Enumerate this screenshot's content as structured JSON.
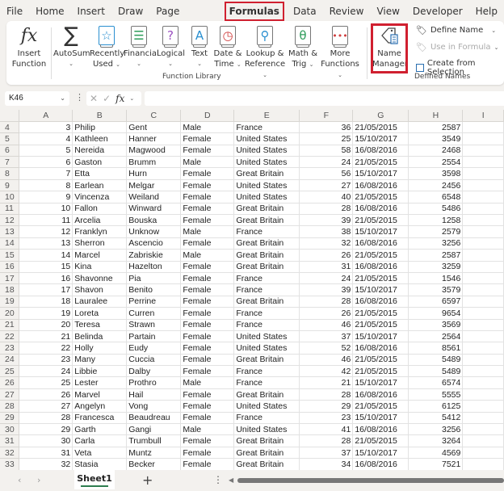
{
  "menu": {
    "tabs": [
      "File",
      "Home",
      "Insert",
      "Draw",
      "Page Layout",
      "Formulas",
      "Data",
      "Review",
      "View",
      "Developer",
      "Help"
    ],
    "active": "Formulas"
  },
  "ribbon": {
    "insert_function": [
      "Insert",
      "Function"
    ],
    "autosum": "AutoSum",
    "recently_used": [
      "Recently",
      "Used"
    ],
    "financial": "Financial",
    "logical": "Logical",
    "text": "Text",
    "date_time": [
      "Date &",
      "Time"
    ],
    "lookup_reference": [
      "Lookup &",
      "Reference"
    ],
    "math_trig": [
      "Math &",
      "Trig"
    ],
    "more_functions": [
      "More",
      "Functions"
    ],
    "function_library_label": "Function Library",
    "name_manager": [
      "Name",
      "Manager"
    ],
    "define_name": "Define Name",
    "use_in_formula": "Use in Formula",
    "create_from_selection": "Create from Selection",
    "defined_names_label": "Defined Names",
    "highlight_color": "#d02030"
  },
  "formula_bar": {
    "name_box": "K46",
    "formula": ""
  },
  "columns": [
    "A",
    "B",
    "C",
    "D",
    "E",
    "F",
    "G",
    "H",
    "I"
  ],
  "rows": [
    {
      "r": "4",
      "c": [
        "3",
        "Philip",
        "Gent",
        "Male",
        "France",
        "36",
        "21/05/2015",
        "2587",
        ""
      ]
    },
    {
      "r": "5",
      "c": [
        "4",
        "Kathleen",
        "Hanner",
        "Female",
        "United States",
        "25",
        "15/10/2017",
        "3549",
        ""
      ]
    },
    {
      "r": "6",
      "c": [
        "5",
        "Nereida",
        "Magwood",
        "Female",
        "United States",
        "58",
        "16/08/2016",
        "2468",
        ""
      ]
    },
    {
      "r": "7",
      "c": [
        "6",
        "Gaston",
        "Brumm",
        "Male",
        "United States",
        "24",
        "21/05/2015",
        "2554",
        ""
      ]
    },
    {
      "r": "8",
      "c": [
        "7",
        "Etta",
        "Hurn",
        "Female",
        "Great Britain",
        "56",
        "15/10/2017",
        "3598",
        ""
      ]
    },
    {
      "r": "9",
      "c": [
        "8",
        "Earlean",
        "Melgar",
        "Female",
        "United States",
        "27",
        "16/08/2016",
        "2456",
        ""
      ]
    },
    {
      "r": "10",
      "c": [
        "9",
        "Vincenza",
        "Weiland",
        "Female",
        "United States",
        "40",
        "21/05/2015",
        "6548",
        ""
      ]
    },
    {
      "r": "11",
      "c": [
        "10",
        "Fallon",
        "Winward",
        "Female",
        "Great Britain",
        "28",
        "16/08/2016",
        "5486",
        ""
      ]
    },
    {
      "r": "12",
      "c": [
        "11",
        "Arcelia",
        "Bouska",
        "Female",
        "Great Britain",
        "39",
        "21/05/2015",
        "1258",
        ""
      ]
    },
    {
      "r": "13",
      "c": [
        "12",
        "Franklyn",
        "Unknow",
        "Male",
        "France",
        "38",
        "15/10/2017",
        "2579",
        ""
      ]
    },
    {
      "r": "14",
      "c": [
        "13",
        "Sherron",
        "Ascencio",
        "Female",
        "Great Britain",
        "32",
        "16/08/2016",
        "3256",
        ""
      ]
    },
    {
      "r": "15",
      "c": [
        "14",
        "Marcel",
        "Zabriskie",
        "Male",
        "Great Britain",
        "26",
        "21/05/2015",
        "2587",
        ""
      ]
    },
    {
      "r": "16",
      "c": [
        "15",
        "Kina",
        "Hazelton",
        "Female",
        "Great Britain",
        "31",
        "16/08/2016",
        "3259",
        ""
      ]
    },
    {
      "r": "17",
      "c": [
        "16",
        "Shavonne",
        "Pia",
        "Female",
        "France",
        "24",
        "21/05/2015",
        "1546",
        ""
      ]
    },
    {
      "r": "18",
      "c": [
        "17",
        "Shavon",
        "Benito",
        "Female",
        "France",
        "39",
        "15/10/2017",
        "3579",
        ""
      ]
    },
    {
      "r": "19",
      "c": [
        "18",
        "Lauralee",
        "Perrine",
        "Female",
        "Great Britain",
        "28",
        "16/08/2016",
        "6597",
        ""
      ]
    },
    {
      "r": "20",
      "c": [
        "19",
        "Loreta",
        "Curren",
        "Female",
        "France",
        "26",
        "21/05/2015",
        "9654",
        ""
      ]
    },
    {
      "r": "21",
      "c": [
        "20",
        "Teresa",
        "Strawn",
        "Female",
        "France",
        "46",
        "21/05/2015",
        "3569",
        ""
      ]
    },
    {
      "r": "22",
      "c": [
        "21",
        "Belinda",
        "Partain",
        "Female",
        "United States",
        "37",
        "15/10/2017",
        "2564",
        ""
      ]
    },
    {
      "r": "23",
      "c": [
        "22",
        "Holly",
        "Eudy",
        "Female",
        "United States",
        "52",
        "16/08/2016",
        "8561",
        ""
      ]
    },
    {
      "r": "24",
      "c": [
        "23",
        "Many",
        "Cuccia",
        "Female",
        "Great Britain",
        "46",
        "21/05/2015",
        "5489",
        ""
      ]
    },
    {
      "r": "25",
      "c": [
        "24",
        "Libbie",
        "Dalby",
        "Female",
        "France",
        "42",
        "21/05/2015",
        "5489",
        ""
      ]
    },
    {
      "r": "26",
      "c": [
        "25",
        "Lester",
        "Prothro",
        "Male",
        "France",
        "21",
        "15/10/2017",
        "6574",
        ""
      ]
    },
    {
      "r": "27",
      "c": [
        "26",
        "Marvel",
        "Hail",
        "Female",
        "Great Britain",
        "28",
        "16/08/2016",
        "5555",
        ""
      ]
    },
    {
      "r": "28",
      "c": [
        "27",
        "Angelyn",
        "Vong",
        "Female",
        "United States",
        "29",
        "21/05/2015",
        "6125",
        ""
      ]
    },
    {
      "r": "29",
      "c": [
        "28",
        "Francesca",
        "Beaudreau",
        "Female",
        "France",
        "23",
        "15/10/2017",
        "5412",
        ""
      ]
    },
    {
      "r": "30",
      "c": [
        "29",
        "Garth",
        "Gangi",
        "Male",
        "United States",
        "41",
        "16/08/2016",
        "3256",
        ""
      ]
    },
    {
      "r": "31",
      "c": [
        "30",
        "Carla",
        "Trumbull",
        "Female",
        "Great Britain",
        "28",
        "21/05/2015",
        "3264",
        ""
      ]
    },
    {
      "r": "32",
      "c": [
        "31",
        "Veta",
        "Muntz",
        "Female",
        "Great Britain",
        "37",
        "15/10/2017",
        "4569",
        ""
      ]
    },
    {
      "r": "33",
      "c": [
        "32",
        "Stasia",
        "Becker",
        "Female",
        "Great Britain",
        "34",
        "16/08/2016",
        "7521",
        ""
      ]
    }
  ],
  "sheets": {
    "active": "Sheet1",
    "add_label": "+"
  }
}
